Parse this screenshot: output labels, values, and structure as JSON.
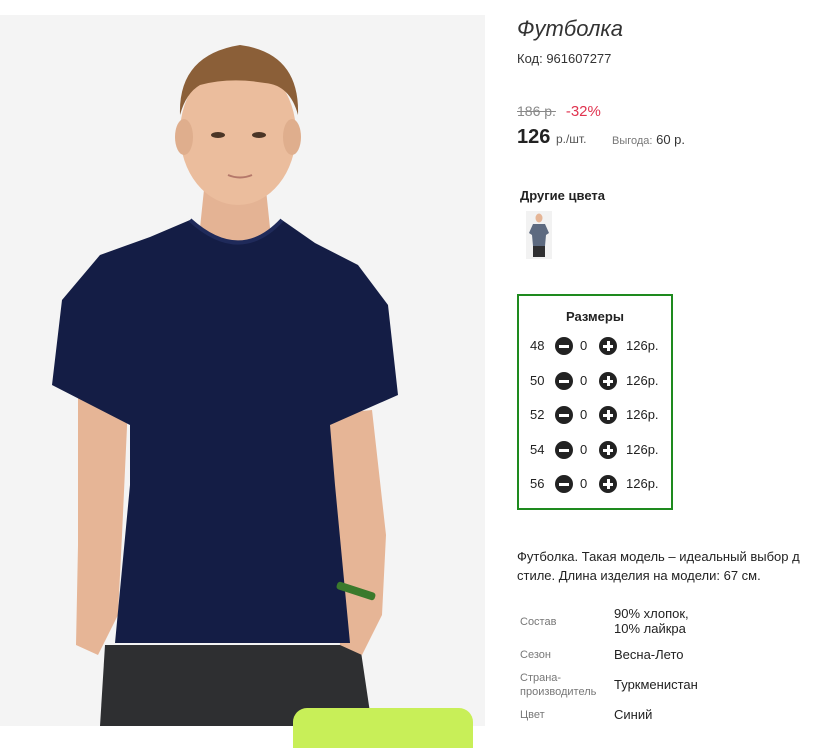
{
  "product": {
    "title": "Футболка",
    "code": "Код: 961607277",
    "old_price": "186 р.",
    "discount": "-32%",
    "price": "126",
    "price_unit": "р./шт.",
    "saving_label": "Выгода:",
    "saving_value": "60 р."
  },
  "other_colors": {
    "title": "Другие цвета",
    "swatches": [
      "grey-tshirt-thumbnail"
    ]
  },
  "sizes": {
    "title": "Размеры",
    "rows": [
      {
        "size": "48",
        "qty": "0",
        "price": "126р."
      },
      {
        "size": "50",
        "qty": "0",
        "price": "126р."
      },
      {
        "size": "52",
        "qty": "0",
        "price": "126р."
      },
      {
        "size": "54",
        "qty": "0",
        "price": "126р."
      },
      {
        "size": "56",
        "qty": "0",
        "price": "126р."
      }
    ]
  },
  "description": {
    "line1": "Футболка. Такая модель – идеальный выбор д",
    "line2": "стиле. Длина изделия на модели: 67 см."
  },
  "attributes": [
    {
      "label": "Состав",
      "value": "90% хлопок,",
      "value2": "10% лайкра"
    },
    {
      "label": "Сезон",
      "value": "Весна-Лето"
    },
    {
      "label": "Страна-",
      "label2": "производитель",
      "value": "Туркменистан"
    },
    {
      "label": "Цвет",
      "value": "Синий"
    }
  ],
  "colors": {
    "accent_red": "#e0334f",
    "size_border": "#1e8a1e",
    "button_green": "#c8ef58",
    "shirt_navy": "#141d45"
  }
}
